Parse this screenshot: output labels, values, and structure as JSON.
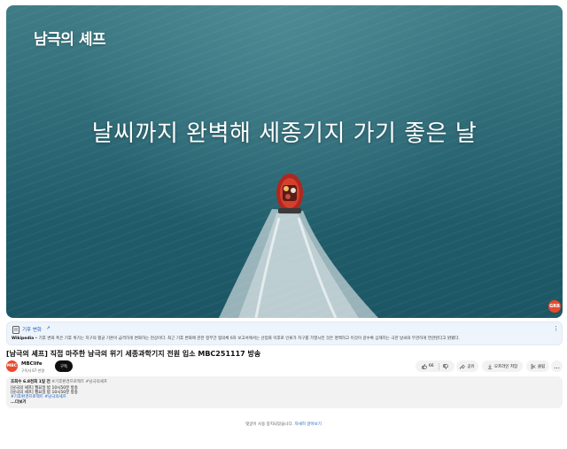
{
  "player": {
    "logo_text": "남극의 셰프",
    "caption": "날씨까지 완벽해 세종기지 가기 좋은 날",
    "watermark": "GRB"
  },
  "info_panel": {
    "title": "기후 변화",
    "link_icon": "external-link-icon",
    "source": "Wikipedia",
    "text": " • 기후 변화 혹은 기후 위기는 지구의 평균 기온이 급격하게 변화하는 현상이다. 최근 기후 변화에 관한 정부간 협의체 6차 보고서에서는 산업화 이후로 인류가 지구를 가열시킨 것은 명백하고 이것이 갈수록 심해지는 극한 날씨와 무관하게 연관된다고 밝혔다."
  },
  "video": {
    "title": "[남극의 셰프] 직접 마주한 남극의 위기 세종과학기지 전원 입소 MBC251117 방송"
  },
  "channel": {
    "avatar_text": "MBC",
    "name": "MBClife",
    "subscribers": "구독자 67 만명",
    "subscribe_label": "구독"
  },
  "actions": {
    "like_count": "66",
    "share_label": "공유",
    "offline_label": "오프라인 저장",
    "clip_label": "클립",
    "more_label": "…"
  },
  "description": {
    "stats": "조회수 6.8천회 1일 전",
    "stats_tags": " #기후환경프로젝트 #남극의셰프",
    "line1": "[남극의 셰프] 월요일 밤 10시50분 방송",
    "line2": "[남극의 셰프] 월요일 밤 10시50분 방송",
    "tags": "#기후환경프로젝트 #남극의셰프",
    "more_label": "...더보기"
  },
  "comments": {
    "text": "댓글이 사용 중지되었습니다.",
    "link": "자세히 알아보기"
  }
}
